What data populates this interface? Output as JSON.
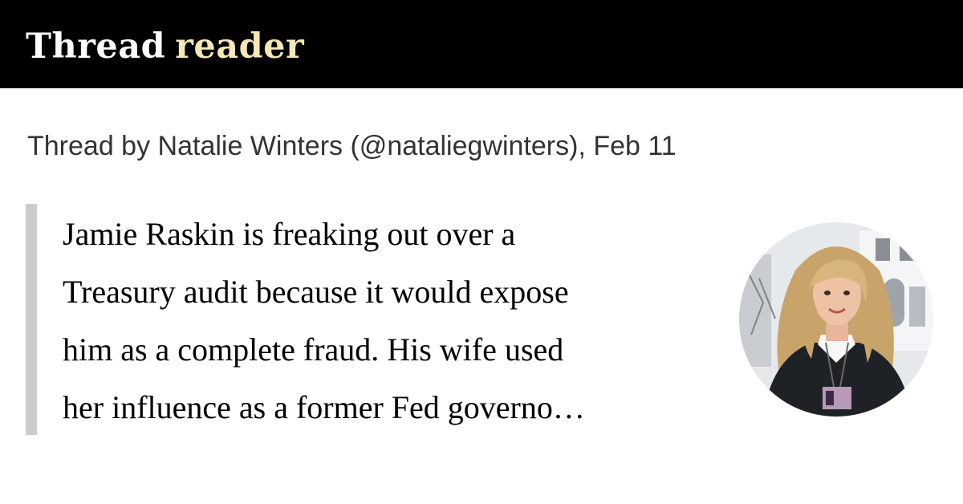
{
  "header": {
    "logo_thread": "Thread",
    "logo_reader": "reader",
    "background": "#000000",
    "accent": "#f6e7b5"
  },
  "byline": "Thread by Natalie Winters (@nataliegwinters), Feb 11",
  "tweet": {
    "lines": [
      "Jamie Raskin is freaking out over a",
      "Treasury audit because it would expose",
      "him as a complete fraud. His wife used",
      "her influence as a former Fed governo…"
    ]
  },
  "avatar": {
    "icon": "profile-photo"
  }
}
